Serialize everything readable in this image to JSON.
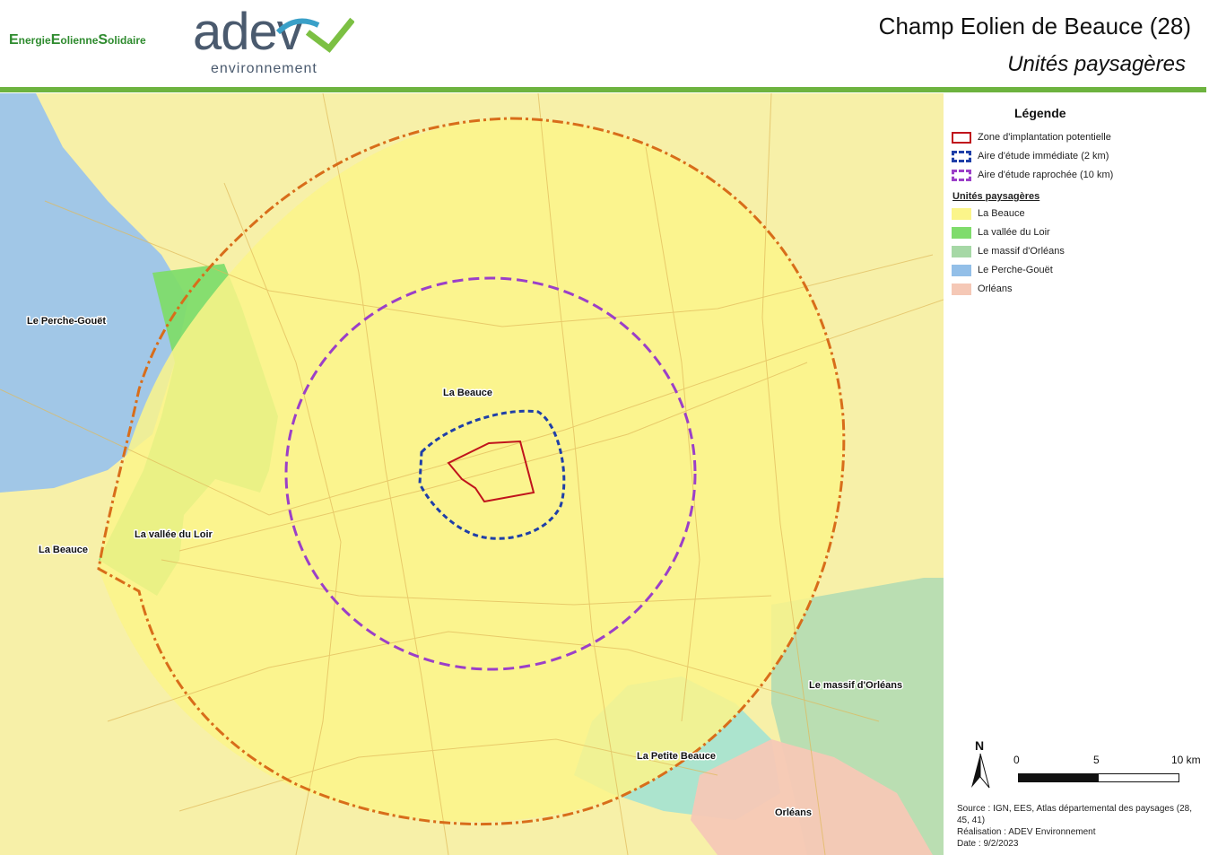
{
  "header": {
    "logo_ees": {
      "e1": "E",
      "w1": "nergie",
      "e2": "E",
      "w2": "olienne",
      "e3": "S",
      "w3": "olidaire"
    },
    "logo_adev": {
      "word": "adev",
      "sub": "environnement"
    },
    "title": "Champ Eolien de Beauce (28)",
    "subtitle": "Unités paysagères"
  },
  "colors": {
    "accent_bar": "#6db33f",
    "la_beauce": "#fbf58a",
    "vallee_du_loir": "#7fdc6c",
    "massif_orleans": "#a6d8a6",
    "perche_gouet": "#93bfe8",
    "orleans": "#f5c8b6",
    "zone_implantation": "#c0141c",
    "aire_immediate": "#1f3fa8",
    "aire_rapprochee": "#9b3fc8",
    "aire_eloignee": "#d86d1a"
  },
  "legend": {
    "title": "Légende",
    "items": [
      {
        "label": "Zone d'implantation potentielle",
        "icon": "red-outline-rect"
      },
      {
        "label": "Aire d'étude immédiate (2 km)",
        "icon": "blue-dashed-rect"
      },
      {
        "label": "Aire d'étude raprochée (10 km)",
        "icon": "purple-dashed-rect"
      }
    ],
    "units_title": "Unités paysagères",
    "units": [
      {
        "label": "La Beauce",
        "color": "#fbf58a"
      },
      {
        "label": "La vallée du Loir",
        "color": "#7fdc6c"
      },
      {
        "label": "Le massif d'Orléans",
        "color": "#a6d8a6"
      },
      {
        "label": "Le Perche-Gouët",
        "color": "#93bfe8"
      },
      {
        "label": "Orléans",
        "color": "#f5c8b6"
      }
    ]
  },
  "map_labels": {
    "perche_gouet": "Le Perche-Gouët",
    "la_beauce_center": "La Beauce",
    "la_beauce_west": "La Beauce",
    "vallee_du_loir": "La vallée du Loir",
    "massif_orleans": "Le massif d'Orléans",
    "petite_beauce": "La Petite Beauce",
    "orleans": "Orléans"
  },
  "scale_bar": {
    "north": "N",
    "ticks": [
      "0",
      "5",
      "10 km"
    ]
  },
  "source": {
    "line1": "Source : IGN, EES, Atlas départemental des paysages (28, 45, 41)",
    "line2": "Réalisation : ADEV Environnement",
    "line3": "Date : 9/2/2023"
  }
}
